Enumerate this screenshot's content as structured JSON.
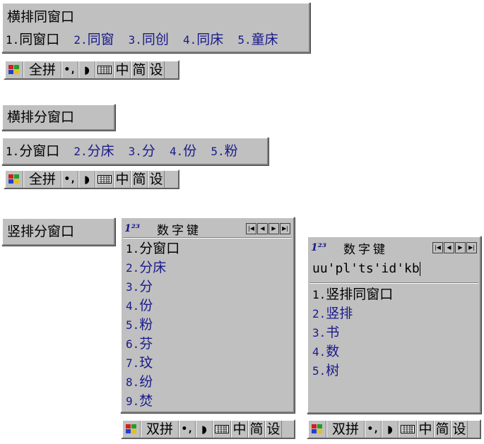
{
  "panel1": {
    "composition": "横排同窗口",
    "candidates": [
      {
        "num": "1.",
        "text": "同窗口"
      },
      {
        "num": "2.",
        "text": "同窗"
      },
      {
        "num": "3.",
        "text": "同创"
      },
      {
        "num": "4.",
        "text": "同床"
      },
      {
        "num": "5.",
        "text": "童床"
      }
    ]
  },
  "status1": {
    "logo": "ime-logo-icon",
    "mode": "全拼",
    "punct": "•,",
    "moon": "◗",
    "keyboard": "keyboard-icon",
    "lang": "中",
    "charset": "简",
    "settings": "设"
  },
  "panel2": {
    "composition": "横排分窗口",
    "candidates": [
      {
        "num": "1.",
        "text": "分窗口"
      },
      {
        "num": "2.",
        "text": "分床"
      },
      {
        "num": "3.",
        "text": "分"
      },
      {
        "num": "4.",
        "text": "份"
      },
      {
        "num": "5.",
        "text": "粉"
      }
    ]
  },
  "status2": {
    "mode": "全拼",
    "punct": "•,",
    "moon": "◗",
    "lang": "中",
    "charset": "简",
    "settings": "设"
  },
  "panel3": {
    "composition": "竖排分窗口",
    "badge": "1²³",
    "title": "数字键",
    "nav": [
      "|◀",
      "◀",
      "▶",
      "▶|"
    ],
    "candidates": [
      {
        "num": "1.",
        "text": "分窗口"
      },
      {
        "num": "2.",
        "text": "分床"
      },
      {
        "num": "3.",
        "text": "分"
      },
      {
        "num": "4.",
        "text": "份"
      },
      {
        "num": "5.",
        "text": "粉"
      },
      {
        "num": "6.",
        "text": "芬"
      },
      {
        "num": "7.",
        "text": "玟"
      },
      {
        "num": "8.",
        "text": "纷"
      },
      {
        "num": "9.",
        "text": "焚"
      }
    ]
  },
  "status3": {
    "mode": "双拼",
    "punct": "•,",
    "moon": "◗",
    "lang": "中",
    "charset": "简",
    "settings": "设"
  },
  "panel4": {
    "badge": "1²³",
    "title": "数字键",
    "nav": [
      "|◀",
      "◀",
      "▶",
      "▶|"
    ],
    "input": "uu'pl'ts'id'kb",
    "candidates": [
      {
        "num": "1.",
        "text": "竖排同窗口"
      },
      {
        "num": "2.",
        "text": "竖排"
      },
      {
        "num": "3.",
        "text": "书"
      },
      {
        "num": "4.",
        "text": "数"
      },
      {
        "num": "5.",
        "text": "树"
      }
    ]
  },
  "status4": {
    "mode": "双拼",
    "punct": "•,",
    "moon": "◗",
    "lang": "中",
    "charset": "简",
    "settings": "设"
  }
}
